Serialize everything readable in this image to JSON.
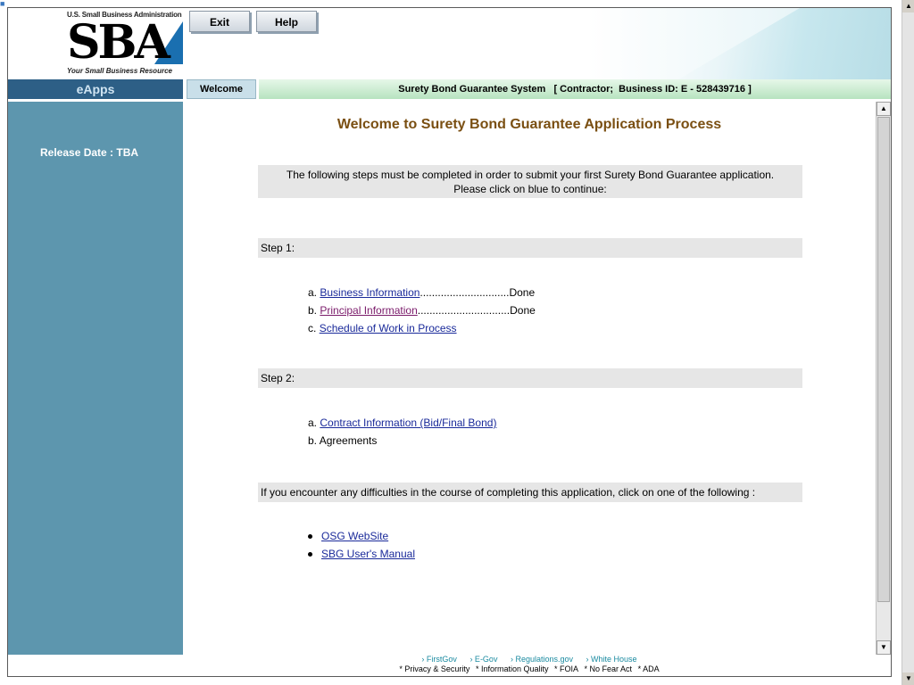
{
  "header": {
    "logo": {
      "top_text": "U.S. Small Business Administration",
      "letters": "SBA",
      "tagline": "Your Small Business Resource"
    },
    "buttons": {
      "exit": "Exit",
      "help": "Help"
    }
  },
  "nav": {
    "brand": "eApps",
    "welcome_tab": "Welcome",
    "system_title": "Surety Bond Guarantee System   [ Contractor;  Business ID: E - 528439716 ]"
  },
  "sidebar": {
    "release_date": "Release Date : TBA"
  },
  "main": {
    "title": "Welcome to Surety Bond Guarantee Application Process",
    "intro_line1": "The following steps must be completed in order to submit your first Surety Bond Guarantee application.",
    "intro_line2": "Please click on blue to continue:",
    "step1": {
      "heading": "Step 1:",
      "items": [
        {
          "prefix": "a.",
          "link": "Business Information",
          "dots": "..............................",
          "status": "Done"
        },
        {
          "prefix": "b.",
          "link": "Principal Information",
          "dots": "...............................",
          "status": "Done"
        },
        {
          "prefix": "c.",
          "link": "Schedule of Work in Process",
          "dots": "",
          "status": ""
        }
      ]
    },
    "step2": {
      "heading": "Step 2:",
      "items": [
        {
          "prefix": "a.",
          "link": "Contract Information (Bid/Final Bond)"
        },
        {
          "prefix": "b.",
          "text": "Agreements"
        }
      ]
    },
    "help": {
      "heading": "If you encounter any difficulties in the course of completing this application, click on one of the following :",
      "links": [
        "OSG WebSite",
        "SBG User's Manual"
      ]
    }
  },
  "footer": {
    "links": [
      "› FirstGov",
      "› E-Gov",
      "› Regulations.gov",
      "› White House"
    ],
    "legal": [
      "* Privacy & Security",
      "* Information Quality",
      "* FOIA",
      "* No Fear Act",
      "* ADA"
    ]
  },
  "colors": {
    "sidebar": "#5d96ae",
    "brand_bar": "#2d5f86",
    "title": "#7a4f12",
    "link": "#1a2a9a",
    "visited_link": "#7a1a6a"
  }
}
